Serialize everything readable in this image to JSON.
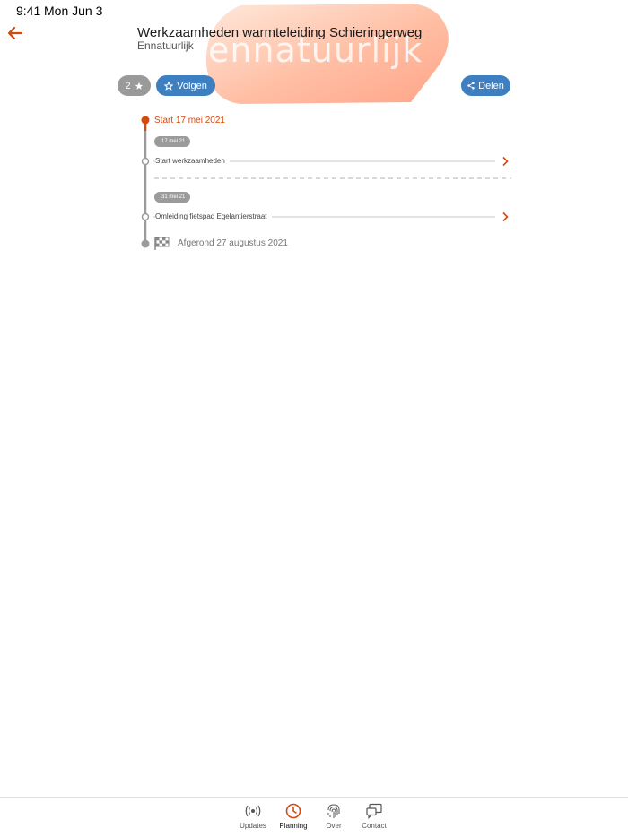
{
  "status_bar": {
    "time": "9:41",
    "date": "Mon Jun 3"
  },
  "header": {
    "title": "Werkzaamheden warmteleiding Schieringerweg",
    "subtitle": "Ennatuurlijk",
    "brand_logo_text": "ennatuurlijk"
  },
  "actions": {
    "followers_count": "2",
    "follow_label": "Volgen",
    "share_label": "Delen"
  },
  "timeline": {
    "start_label": "Start 17 mei 2021",
    "items": [
      {
        "date_tag": "17 mei 21",
        "label": "Start werkzaamheden"
      },
      {
        "date_tag": "31 mei 21",
        "label": "Omleiding fietspad Egelantierstraat"
      }
    ],
    "finish_label": "Afgerond 27 augustus 2021"
  },
  "tab_bar": {
    "tabs": [
      {
        "label": "Updates",
        "icon": "broadcast-icon"
      },
      {
        "label": "Planning",
        "icon": "clock-icon",
        "active": true
      },
      {
        "label": "Over",
        "icon": "fingerprint-icon"
      },
      {
        "label": "Contact",
        "icon": "chat-icon"
      }
    ]
  },
  "colors": {
    "accent": "#d34a0f",
    "button_blue": "#3d7fc1",
    "badge_gray": "#9a9a9a",
    "timeline_gray": "#9b9b9b"
  }
}
